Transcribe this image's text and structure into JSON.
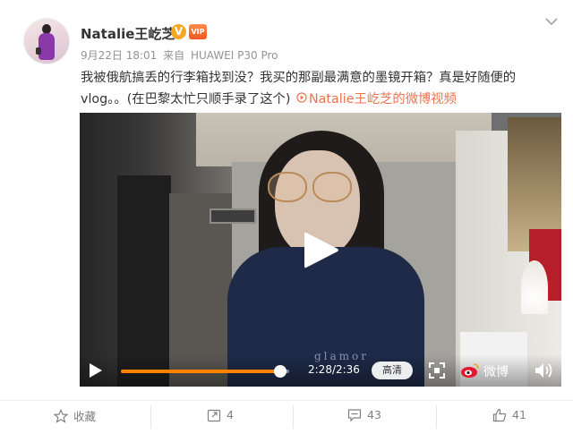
{
  "post": {
    "author": "Natalie王屹芝",
    "verified_mark": "V",
    "vip_badge": "VIP",
    "date": "9月22日 18:01",
    "source_prefix": "来自",
    "device": "HUAWEI P30 Pro",
    "text_line1": "我被俄航搞丢的行李箱找到没？我买的那副最满意的墨镜开箱？真是好随便的",
    "text_line2": "vlog。。(在巴黎太忙只顺手录了这个)",
    "video_link": "Natalie王屹芝的微博视频",
    "video_link_icon": "video-play-icon"
  },
  "video": {
    "current_time": "2:28",
    "duration": "2:36",
    "time_display": "2:28/2:36",
    "progress_fraction": 0.949,
    "quality_label": "高清",
    "brand_label": "微博",
    "shirt_print": "glamor"
  },
  "actions": {
    "favorite_label": "收藏",
    "repost_count": "4",
    "comment_count": "43",
    "like_count": "41"
  },
  "colors": {
    "link": "#eb7350",
    "progress": "#ff8200",
    "verified": "#f5a623",
    "action_text": "#808080"
  }
}
